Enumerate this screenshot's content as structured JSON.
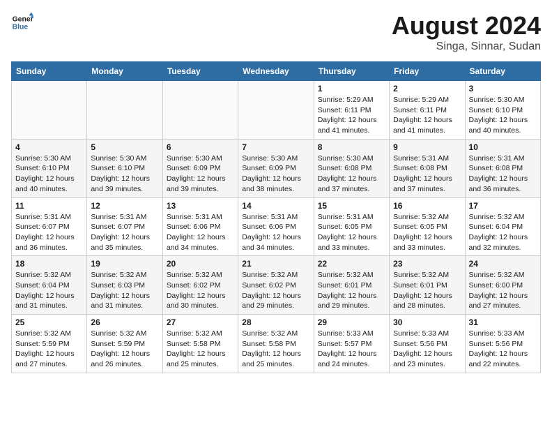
{
  "header": {
    "logo_line1": "General",
    "logo_line2": "Blue",
    "title": "August 2024",
    "subtitle": "Singa, Sinnar, Sudan"
  },
  "weekdays": [
    "Sunday",
    "Monday",
    "Tuesday",
    "Wednesday",
    "Thursday",
    "Friday",
    "Saturday"
  ],
  "weeks": [
    [
      {
        "day": "",
        "info": ""
      },
      {
        "day": "",
        "info": ""
      },
      {
        "day": "",
        "info": ""
      },
      {
        "day": "",
        "info": ""
      },
      {
        "day": "1",
        "info": "Sunrise: 5:29 AM\nSunset: 6:11 PM\nDaylight: 12 hours and 41 minutes."
      },
      {
        "day": "2",
        "info": "Sunrise: 5:29 AM\nSunset: 6:11 PM\nDaylight: 12 hours and 41 minutes."
      },
      {
        "day": "3",
        "info": "Sunrise: 5:30 AM\nSunset: 6:10 PM\nDaylight: 12 hours and 40 minutes."
      }
    ],
    [
      {
        "day": "4",
        "info": "Sunrise: 5:30 AM\nSunset: 6:10 PM\nDaylight: 12 hours and 40 minutes."
      },
      {
        "day": "5",
        "info": "Sunrise: 5:30 AM\nSunset: 6:10 PM\nDaylight: 12 hours and 39 minutes."
      },
      {
        "day": "6",
        "info": "Sunrise: 5:30 AM\nSunset: 6:09 PM\nDaylight: 12 hours and 39 minutes."
      },
      {
        "day": "7",
        "info": "Sunrise: 5:30 AM\nSunset: 6:09 PM\nDaylight: 12 hours and 38 minutes."
      },
      {
        "day": "8",
        "info": "Sunrise: 5:30 AM\nSunset: 6:08 PM\nDaylight: 12 hours and 37 minutes."
      },
      {
        "day": "9",
        "info": "Sunrise: 5:31 AM\nSunset: 6:08 PM\nDaylight: 12 hours and 37 minutes."
      },
      {
        "day": "10",
        "info": "Sunrise: 5:31 AM\nSunset: 6:08 PM\nDaylight: 12 hours and 36 minutes."
      }
    ],
    [
      {
        "day": "11",
        "info": "Sunrise: 5:31 AM\nSunset: 6:07 PM\nDaylight: 12 hours and 36 minutes."
      },
      {
        "day": "12",
        "info": "Sunrise: 5:31 AM\nSunset: 6:07 PM\nDaylight: 12 hours and 35 minutes."
      },
      {
        "day": "13",
        "info": "Sunrise: 5:31 AM\nSunset: 6:06 PM\nDaylight: 12 hours and 34 minutes."
      },
      {
        "day": "14",
        "info": "Sunrise: 5:31 AM\nSunset: 6:06 PM\nDaylight: 12 hours and 34 minutes."
      },
      {
        "day": "15",
        "info": "Sunrise: 5:31 AM\nSunset: 6:05 PM\nDaylight: 12 hours and 33 minutes."
      },
      {
        "day": "16",
        "info": "Sunrise: 5:32 AM\nSunset: 6:05 PM\nDaylight: 12 hours and 33 minutes."
      },
      {
        "day": "17",
        "info": "Sunrise: 5:32 AM\nSunset: 6:04 PM\nDaylight: 12 hours and 32 minutes."
      }
    ],
    [
      {
        "day": "18",
        "info": "Sunrise: 5:32 AM\nSunset: 6:04 PM\nDaylight: 12 hours and 31 minutes."
      },
      {
        "day": "19",
        "info": "Sunrise: 5:32 AM\nSunset: 6:03 PM\nDaylight: 12 hours and 31 minutes."
      },
      {
        "day": "20",
        "info": "Sunrise: 5:32 AM\nSunset: 6:02 PM\nDaylight: 12 hours and 30 minutes."
      },
      {
        "day": "21",
        "info": "Sunrise: 5:32 AM\nSunset: 6:02 PM\nDaylight: 12 hours and 29 minutes."
      },
      {
        "day": "22",
        "info": "Sunrise: 5:32 AM\nSunset: 6:01 PM\nDaylight: 12 hours and 29 minutes."
      },
      {
        "day": "23",
        "info": "Sunrise: 5:32 AM\nSunset: 6:01 PM\nDaylight: 12 hours and 28 minutes."
      },
      {
        "day": "24",
        "info": "Sunrise: 5:32 AM\nSunset: 6:00 PM\nDaylight: 12 hours and 27 minutes."
      }
    ],
    [
      {
        "day": "25",
        "info": "Sunrise: 5:32 AM\nSunset: 5:59 PM\nDaylight: 12 hours and 27 minutes."
      },
      {
        "day": "26",
        "info": "Sunrise: 5:32 AM\nSunset: 5:59 PM\nDaylight: 12 hours and 26 minutes."
      },
      {
        "day": "27",
        "info": "Sunrise: 5:32 AM\nSunset: 5:58 PM\nDaylight: 12 hours and 25 minutes."
      },
      {
        "day": "28",
        "info": "Sunrise: 5:32 AM\nSunset: 5:58 PM\nDaylight: 12 hours and 25 minutes."
      },
      {
        "day": "29",
        "info": "Sunrise: 5:33 AM\nSunset: 5:57 PM\nDaylight: 12 hours and 24 minutes."
      },
      {
        "day": "30",
        "info": "Sunrise: 5:33 AM\nSunset: 5:56 PM\nDaylight: 12 hours and 23 minutes."
      },
      {
        "day": "31",
        "info": "Sunrise: 5:33 AM\nSunset: 5:56 PM\nDaylight: 12 hours and 22 minutes."
      }
    ]
  ]
}
